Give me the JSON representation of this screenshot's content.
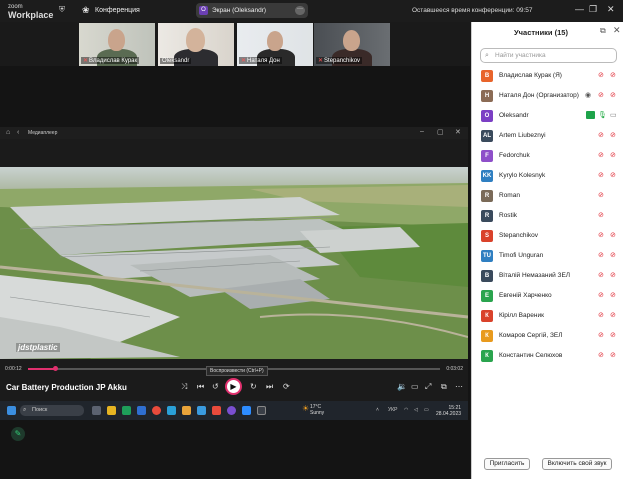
{
  "zoom": {
    "logo_small": "zoom",
    "logo_big": "Workplace",
    "meeting_label": "Конференция",
    "screen_share_label": "Экран (Oleksandr)",
    "screen_share_avatar": "O",
    "time_left": "Оставшееся время конференции: 09:57"
  },
  "thumbnails": [
    {
      "name": "Владислав Курак",
      "active": true
    },
    {
      "name": "Oleksandr",
      "active": false
    },
    {
      "name": "Наталя Дон",
      "active": false
    },
    {
      "name": "Stepanchikov",
      "active": false
    }
  ],
  "media_player": {
    "app_label": "Медиаплеер",
    "brand_overlay": "jdstplastic",
    "time_current": "0:00:12",
    "time_total": "0:03:02",
    "progress_fraction": 0.066,
    "title": "Car Battery Production JP Akku",
    "tooltip": "Воспроизвести (Ctrl+P)"
  },
  "taskbar": {
    "search_placeholder": "Поиск",
    "weather_temp": "17°C",
    "weather_desc": "Sunny",
    "lang": "УКР",
    "time": "15:21",
    "date": "28.04.2023"
  },
  "participants": {
    "title": "Участники (15)",
    "search_placeholder": "Найти участника",
    "items": [
      {
        "initials": "В",
        "name": "Владислав Курак (Я)",
        "color": "#e8642b",
        "mic": "off",
        "cam": "off"
      },
      {
        "initials": "Н",
        "name": "Наталя Дон (Организатор)",
        "color": "#8b6b55",
        "mic": "off",
        "cam": "off",
        "recording": true
      },
      {
        "initials": "O",
        "name": "Oleksandr",
        "color": "#7b3fc4",
        "mic": "on",
        "cam": "on"
      },
      {
        "initials": "AL",
        "name": "Artem Liubeznyi",
        "color": "#3a4a5c",
        "mic": "off",
        "cam": "off"
      },
      {
        "initials": "F",
        "name": "Fedorchuk",
        "color": "#8e4fc9",
        "mic": "off",
        "cam": "off"
      },
      {
        "initials": "KK",
        "name": "Kyrylo Kolesnyk",
        "color": "#2f7fc1",
        "mic": "off",
        "cam": "off"
      },
      {
        "initials": "R",
        "name": "Roman",
        "color": "#7a6a58",
        "mic": "off",
        "cam": "none"
      },
      {
        "initials": "R",
        "name": "Rostik",
        "color": "#3a4a5c",
        "mic": "off",
        "cam": "none"
      },
      {
        "initials": "S",
        "name": "Stepanchikov",
        "color": "#d9422b",
        "mic": "off",
        "cam": "off"
      },
      {
        "initials": "TU",
        "name": "Timofi Unguran",
        "color": "#2f7fc1",
        "mic": "off",
        "cam": "off"
      },
      {
        "initials": "В",
        "name": "Віталій Немазаний ЗЕЛ",
        "color": "#3a4a5c",
        "mic": "off",
        "cam": "off"
      },
      {
        "initials": "Е",
        "name": "Евгеній Харченко",
        "color": "#2aa44e",
        "mic": "off",
        "cam": "off"
      },
      {
        "initials": "К",
        "name": "Кірілл Вареник",
        "color": "#d9422b",
        "mic": "off",
        "cam": "off"
      },
      {
        "initials": "К",
        "name": "Комаров Сергій, ЗЕЛ",
        "color": "#e89a1e",
        "mic": "off",
        "cam": "off"
      },
      {
        "initials": "К",
        "name": "Константин Селюхов",
        "color": "#2aa44e",
        "mic": "off",
        "cam": "off"
      }
    ],
    "invite_label": "Пригласить",
    "unmute_label": "Включить свой звук"
  }
}
